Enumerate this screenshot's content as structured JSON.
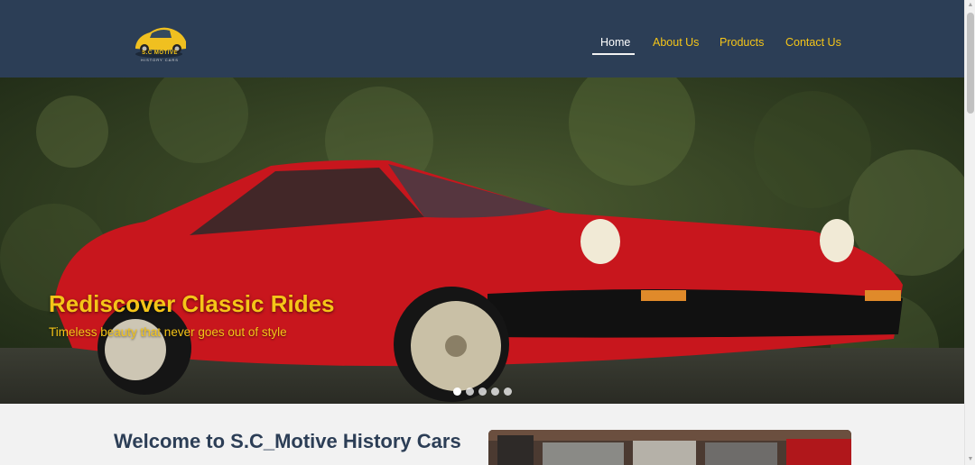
{
  "header": {
    "logo_alt": "S.C Motive History Cars logo",
    "logo_text": "S.C MOTIVE",
    "logo_subtext": "HISTORY CARS",
    "nav": [
      {
        "label": "Home",
        "active": true
      },
      {
        "label": "About Us",
        "active": false
      },
      {
        "label": "Products",
        "active": false
      },
      {
        "label": "Contact Us",
        "active": false
      }
    ]
  },
  "hero": {
    "title": "Rediscover Classic Rides",
    "subtitle": "Timeless beauty that never goes out of style",
    "slide_count": 5,
    "active_slide": 1
  },
  "welcome": {
    "title": "Welcome to S.C_Motive History Cars"
  },
  "colors": {
    "header_bg": "#2c3e56",
    "accent": "#f5c518",
    "page_bg": "#f2f2f2",
    "car_red": "#c8161d"
  }
}
